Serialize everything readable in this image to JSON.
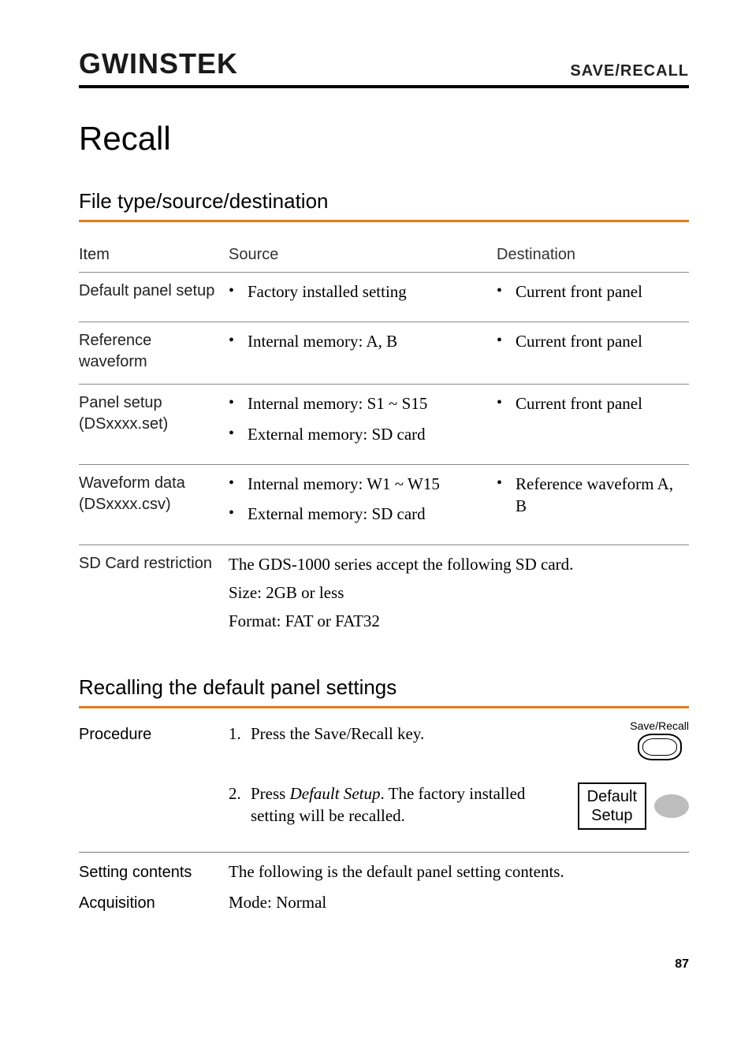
{
  "header": {
    "logo_text": "GWINSTEK",
    "breadcrumb": "SAVE/RECALL"
  },
  "title": "Recall",
  "section1": {
    "heading": "File type/source/destination",
    "columns": {
      "item": "Item",
      "source": "Source",
      "destination": "Destination"
    },
    "rows": [
      {
        "item": "Default panel setup",
        "source": [
          "Factory installed setting"
        ],
        "destination": [
          "Current front panel"
        ]
      },
      {
        "item": "Reference waveform",
        "source": [
          "Internal memory: A, B"
        ],
        "destination": [
          "Current front panel"
        ]
      },
      {
        "item": "Panel setup (DSxxxx.set)",
        "source": [
          "Internal memory: S1 ~ S15",
          "External memory: SD card"
        ],
        "destination": [
          "Current front panel"
        ]
      },
      {
        "item": "Waveform data (DSxxxx.csv)",
        "source": [
          "Internal memory: W1 ~ W15",
          "External memory: SD card"
        ],
        "destination": [
          "Reference waveform A, B"
        ]
      }
    ],
    "sdcard": {
      "label": "SD Card restriction",
      "line1": "The GDS-1000 series accept the following SD card.",
      "line2": "Size: 2GB or less",
      "line3": "Format: FAT or FAT32"
    }
  },
  "section2": {
    "heading": "Recalling the default panel settings",
    "procedure_label": "Procedure",
    "step1_num": "1.",
    "step1_text": "Press the Save/Recall key.",
    "step1_key_caption": "Save/Recall",
    "step2_num": "2.",
    "step2_prefix": "Press ",
    "step2_em": "Default Setup",
    "step2_suffix": ". The factory installed setting will be recalled.",
    "softkey_line1": "Default",
    "softkey_line2": "Setup",
    "setting_contents_label": "Setting contents",
    "setting_contents_text": "The following is the default panel setting contents.",
    "acq_label": "Acquisition",
    "acq_text": "Mode: Normal"
  },
  "page_number": "87"
}
